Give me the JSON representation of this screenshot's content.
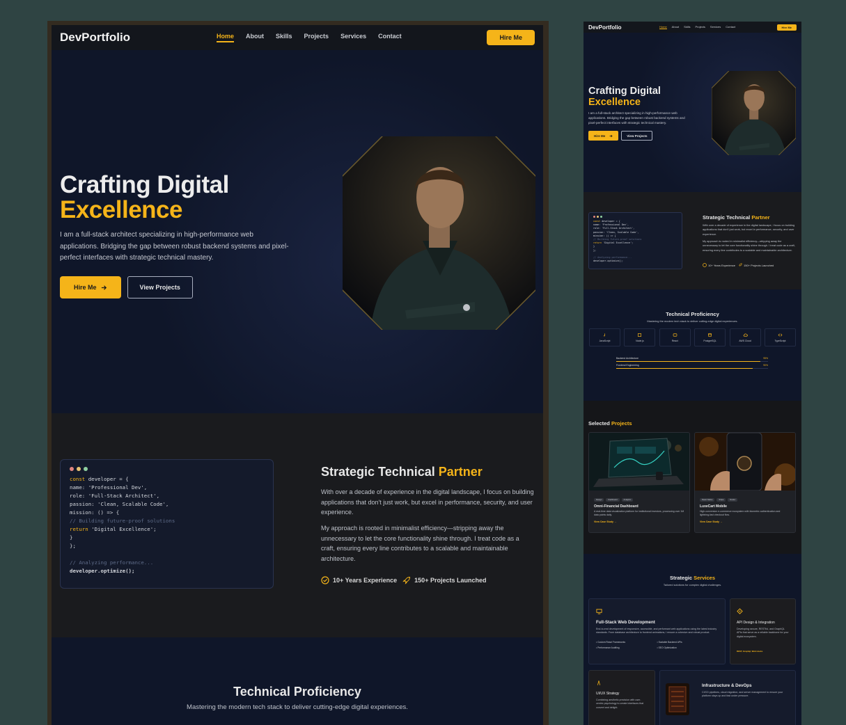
{
  "site": {
    "logo": "DevPortfolio",
    "nav": [
      "Home",
      "About",
      "Skills",
      "Projects",
      "Services",
      "Contact"
    ],
    "active_nav": "Home",
    "hire_cta": "Hire Me"
  },
  "hero": {
    "title_line1": "Crafting Digital",
    "title_line2": "Excellence",
    "description": "I am a full-stack architect specializing in high-performance web applications. Bridging the gap between robust backend systems and pixel-perfect interfaces with strategic technical mastery.",
    "primary_button": "Hire Me",
    "secondary_button": "View Projects"
  },
  "about": {
    "code": {
      "line1_kw": "const",
      "line1_rest": " developer = {",
      "line2": "  name: 'Professional Dev',",
      "line3": "  role: 'Full-Stack Architect',",
      "line4": "  passion: 'Clean, Scalable Code',",
      "line5": "  mission: () => {",
      "line6": "    // Building future-proof solutions",
      "line7_kw": "    return",
      "line7_rest": " 'Digital Excellence';",
      "line8": "  }",
      "line9": "};",
      "line10": "// Analyzing performance...",
      "line11": "developer.optimize();"
    },
    "title_part1": "Strategic Technical ",
    "title_accent": "Partner",
    "paragraph1": "With over a decade of experience in the digital landscape, I focus on building applications that don't just work, but excel in performance, security, and user experience.",
    "paragraph2": "My approach is rooted in minimalist efficiency—stripping away the unnecessary to let the core functionality shine through. I treat code as a craft, ensuring every line contributes to a scalable and maintainable architecture.",
    "stat1": "10+ Years Experience",
    "stat2": "150+ Projects Launched"
  },
  "proficiency": {
    "title": "Technical Proficiency",
    "subtitle": "Mastering the modern tech stack to deliver cutting-edge digital experiences.",
    "skills": [
      "JavaScript",
      "Node.js",
      "React",
      "PostgreSQL",
      "AWS Cloud",
      "TypeScript"
    ],
    "bars": [
      {
        "label": "Backend Architecture",
        "percent": "95%",
        "value": 0.95
      },
      {
        "label": "Frontend Engineering",
        "percent": "90%",
        "value": 0.9
      }
    ]
  },
  "projects": {
    "title_part1": "Selected ",
    "title_accent": "Projects",
    "items": [
      {
        "tags": [
          "Design",
          "Dashboard",
          "Analytics"
        ],
        "title": "Omni-Financial Dashboard",
        "description": "A real-time data visualization platform for institutional investors, processing over 1M data points daily.",
        "link": "View Case Study"
      },
      {
        "tags": [
          "React Native",
          "Stripe",
          "Redux"
        ],
        "title": "LuxeCart Mobile",
        "description": "High-conversion e-commerce ecosystem with biometric authentication and lightning-fast checkout flow.",
        "link": "View Case Study"
      }
    ]
  },
  "services": {
    "title_part1": "Strategic ",
    "title_accent": "Services",
    "subtitle": "Tailored solutions for complex digital challenges.",
    "fullstack": {
      "title": "Full-Stack Web Development",
      "description": "End-to-end development of responsive, accessible, and performant web applications using the latest industry standards. From database architecture to frontend animations, I ensure a cohesive and robust product.",
      "bullets": [
        "Custom React Frameworks",
        "Scalable Backend APIs",
        "Performance Auditing",
        "SEO Optimization"
      ]
    },
    "api": {
      "title": "API Design & Integration",
      "description": "Developing secure, RESTful, and GraphQL APIs that serve as a reliable backbone for your digital ecosystem.",
      "meta": "REST, Graphql, Web Hooks"
    },
    "uiux": {
      "title": "UI/UX Strategy",
      "description": "Combining aesthetic precision with user-centric psychology to create interfaces that convert and delight."
    },
    "infra": {
      "title": "Infrastructure & DevOps",
      "description": "CI/CD pipelines, cloud migration, and server management to ensure your platform stays up and fast under pressure."
    }
  },
  "colors": {
    "accent": "#f5b419",
    "background_navy": "#0f1629",
    "background_dark": "#1a1b1e",
    "desktop": "#2f4443"
  },
  "icons": [
    "check-circle-icon",
    "rocket-icon",
    "arrow-right-icon",
    "js-icon",
    "node-icon",
    "react-icon",
    "database-icon",
    "cloud-icon",
    "code-icon",
    "monitor-icon",
    "api-icon",
    "uiux-icon"
  ]
}
